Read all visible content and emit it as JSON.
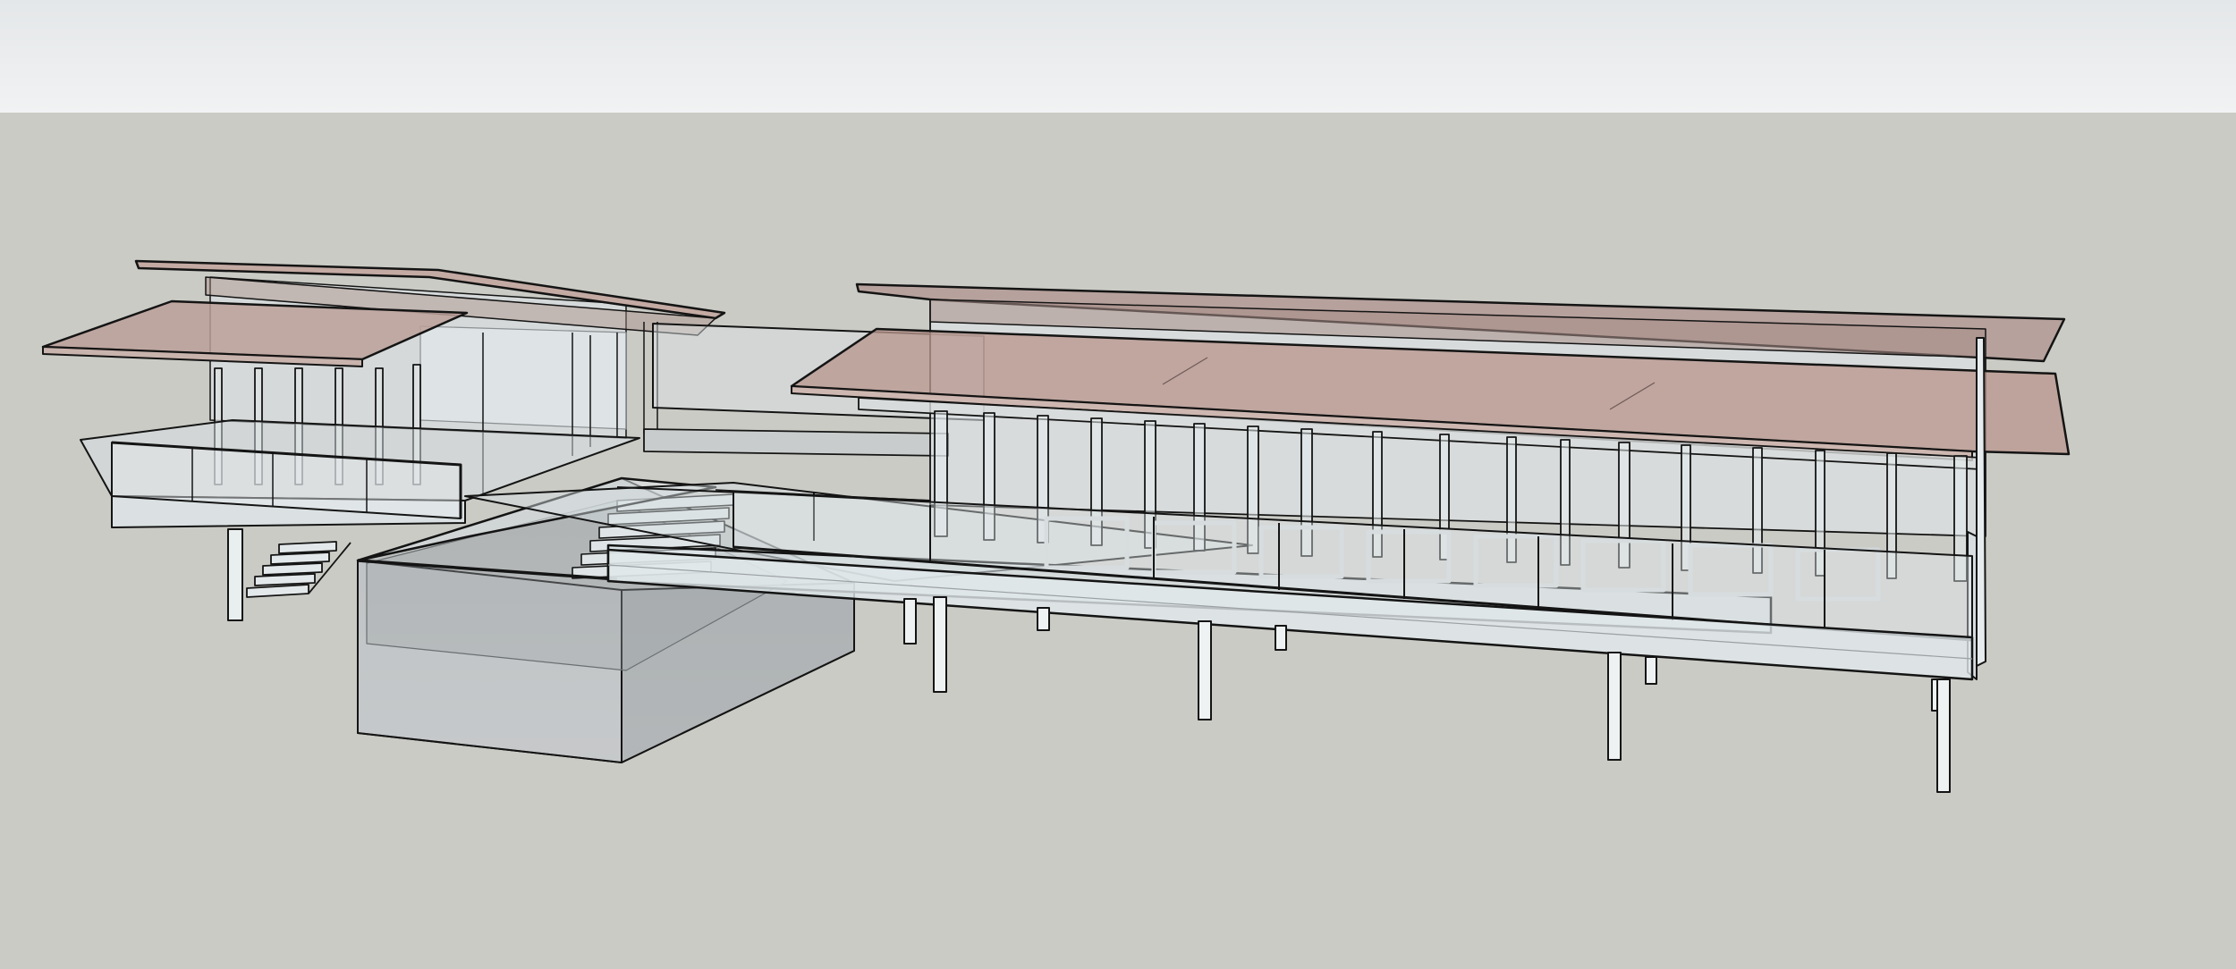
{
  "app": {
    "kind": "3d-modeling-viewport",
    "render_style": "x-ray"
  },
  "scene": {
    "subject": "pavilion-house-model",
    "sky_color": "#eef0f1",
    "ground_color": "#cbcbc6",
    "roof_color": "#b89b94",
    "glass_color": "#dfe6ea",
    "frame_color": "#d9dcdc",
    "edge_color": "#141414"
  }
}
